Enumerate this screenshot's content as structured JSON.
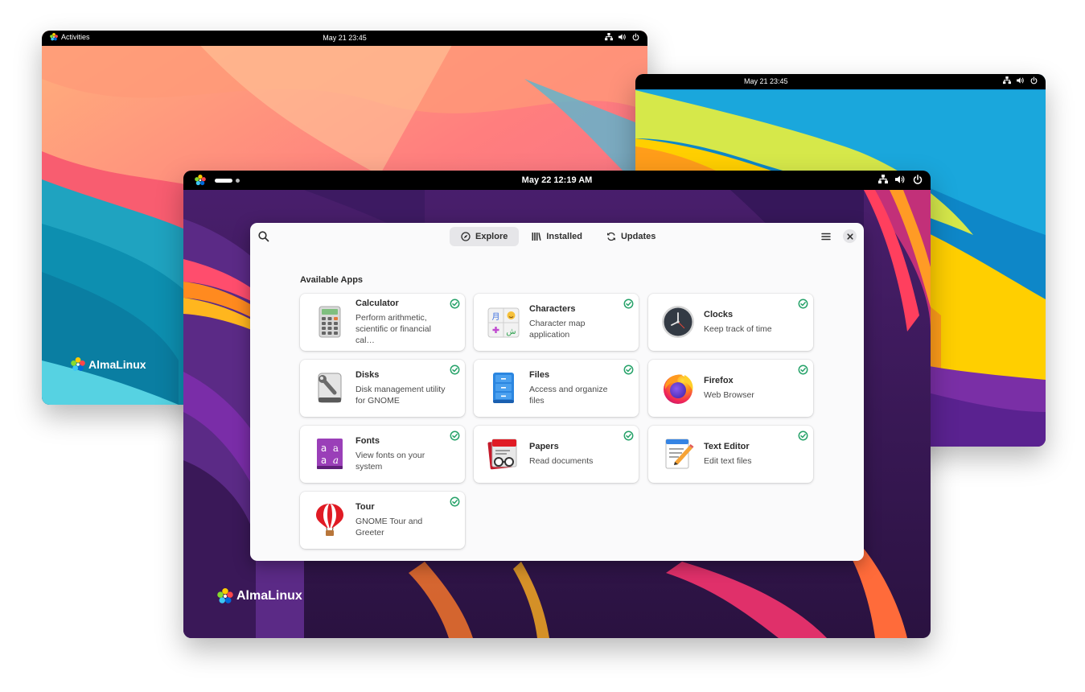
{
  "back_left_screen": {
    "activities_label": "Activities",
    "clock": "May 21  23:45",
    "brand": "AlmaLinux"
  },
  "back_right_screen": {
    "clock": "May 21  23:45"
  },
  "front_screen": {
    "clock": "May 22  12:19 AM",
    "brand": "AlmaLinux"
  },
  "software_window": {
    "tabs": [
      {
        "label": "Explore",
        "icon": "compass-icon",
        "active": true
      },
      {
        "label": "Installed",
        "icon": "library-icon",
        "active": false
      },
      {
        "label": "Updates",
        "icon": "refresh-icon",
        "active": false
      }
    ],
    "section_title": "Available Apps",
    "apps": [
      {
        "name": "Calculator",
        "desc1": "Perform arithmetic,",
        "desc2": "scientific or financial cal…",
        "icon": "calculator-icon",
        "installed": true
      },
      {
        "name": "Characters",
        "desc1": "Character map",
        "desc2": "application",
        "icon": "characters-icon",
        "installed": true
      },
      {
        "name": "Clocks",
        "desc1": "Keep track of time",
        "desc2": "",
        "icon": "clock-icon",
        "installed": true
      },
      {
        "name": "Disks",
        "desc1": "Disk management utility",
        "desc2": "for GNOME",
        "icon": "disks-icon",
        "installed": true
      },
      {
        "name": "Files",
        "desc1": "Access and organize files",
        "desc2": "",
        "icon": "files-icon",
        "installed": true
      },
      {
        "name": "Firefox",
        "desc1": "Web Browser",
        "desc2": "",
        "icon": "firefox-icon",
        "installed": true
      },
      {
        "name": "Fonts",
        "desc1": "View fonts on your system",
        "desc2": "",
        "icon": "fonts-icon",
        "installed": true
      },
      {
        "name": "Papers",
        "desc1": "Read documents",
        "desc2": "",
        "icon": "papers-icon",
        "installed": true
      },
      {
        "name": "Text Editor",
        "desc1": "Edit text files",
        "desc2": "",
        "icon": "text-editor-icon",
        "installed": true
      },
      {
        "name": "Tour",
        "desc1": "GNOME Tour and Greeter",
        "desc2": "",
        "icon": "tour-icon",
        "installed": true
      }
    ],
    "fonts_icon_glyphs": [
      "a",
      "a",
      "a",
      "a"
    ],
    "characters_icon_glyphs": [
      "月",
      "ش"
    ]
  },
  "colors": {
    "installed_check": "#26a269",
    "topbar": "#000000",
    "window_bg": "#fafafb"
  }
}
